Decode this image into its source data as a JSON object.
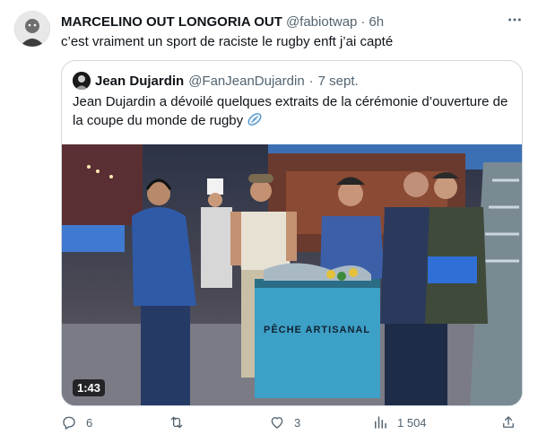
{
  "author": {
    "name": "MARCELINO OUT LONGORIA OUT",
    "handle": "@fabiotwap",
    "dot": "·",
    "time": "6h"
  },
  "tweet_text": "c’est vraiment un sport de raciste le rugby enft j’ai capté",
  "quoted": {
    "name": "Jean Dujardin",
    "handle": "@FanJeanDujardin",
    "dot": "·",
    "time": "7 sept.",
    "text": "Jean Dujardin a dévoilé quelques extraits de la cérémonie d’ouverture de la coupe du monde de rugby",
    "video_duration": "1:43",
    "cart_sign": "PÊCHE ARTISANAL"
  },
  "actions": {
    "reply_count": "6",
    "retweet_count": "",
    "like_count": "3",
    "views_count": "1 504"
  },
  "icons": [
    "more-icon",
    "reply-icon",
    "retweet-icon",
    "like-icon",
    "views-icon",
    "share-icon",
    "rugby-ball-icon"
  ],
  "colors": {
    "text": "#0f1419",
    "secondary": "#536471",
    "border": "#cfd9de"
  }
}
